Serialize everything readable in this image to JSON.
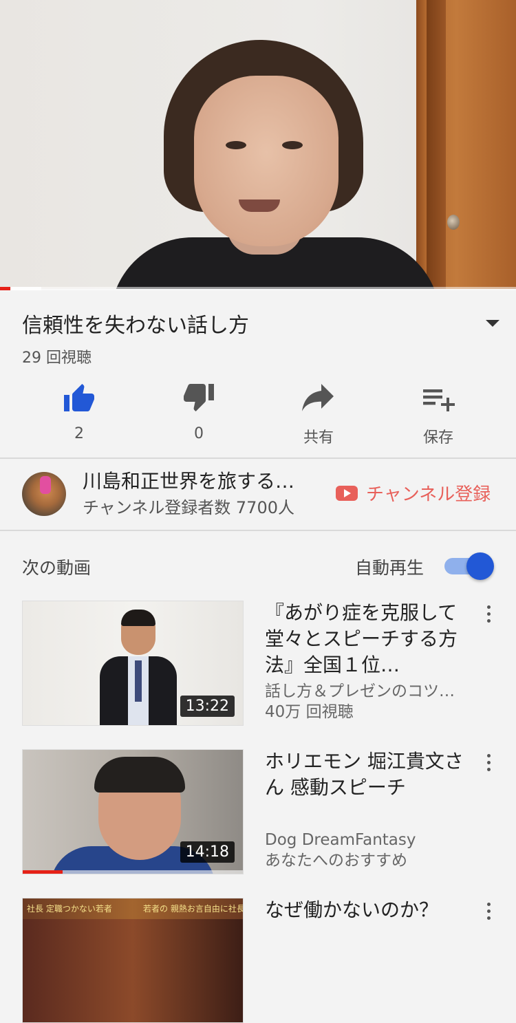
{
  "video": {
    "title": "信頼性を失わない話し方",
    "views": "29 回視聴",
    "progress_fraction": 0.02
  },
  "actions": {
    "like": {
      "label": "2",
      "icon": "thumbs-up-icon",
      "color": "#2258d6"
    },
    "dislike": {
      "label": "0",
      "icon": "thumbs-down-icon"
    },
    "share": {
      "label": "共有",
      "icon": "share-icon"
    },
    "save": {
      "label": "保存",
      "icon": "playlist-add-icon"
    }
  },
  "channel": {
    "name": "川島和正世界を旅する…",
    "subscribers": "チャンネル登録者数 7700人",
    "subscribe_label": "チャンネル登録",
    "subscribe_color": "#e8605a"
  },
  "upnext": {
    "heading": "次の動画",
    "autoplay_label": "自動再生",
    "autoplay_on": true,
    "videos": [
      {
        "title": "『あがり症を克服して堂々とスピーチする方法』全国１位…",
        "channel": "話し方＆プレゼンのコツ…",
        "meta": "40万 回視聴",
        "duration": "13:22"
      },
      {
        "title": "ホリエモン 堀江貴文さん 感動スピーチ",
        "channel": "Dog DreamFantasy",
        "meta": "あなたへのおすすめ",
        "duration": "14:18",
        "watched_fraction": 0.18
      },
      {
        "title": "なぜ働かないのか？",
        "thumb_text_left": "社長 定職つかない若者",
        "thumb_text_right": "若者の 親熱お言自由に社長が喝!"
      }
    ]
  }
}
